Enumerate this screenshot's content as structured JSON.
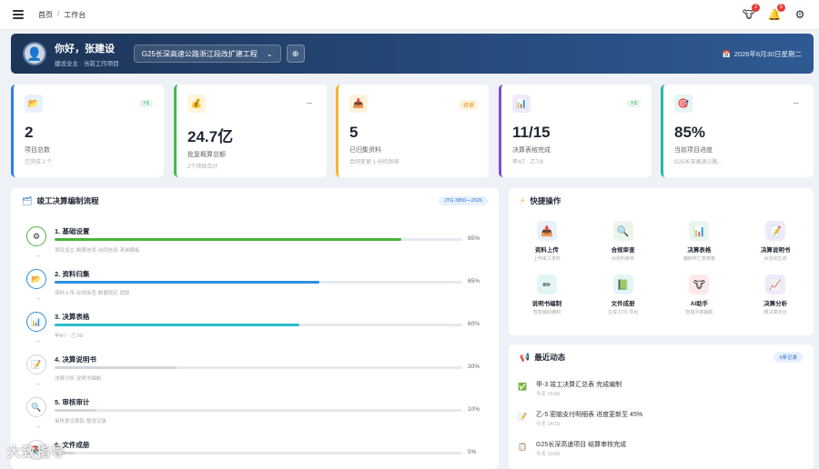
{
  "breadcrumb": {
    "home": "首页",
    "separator": "/",
    "current": "工作台"
  },
  "topbar": {
    "icons": [
      {
        "name": "mascot-icon",
        "glyph": "🐮",
        "badge": "2"
      },
      {
        "name": "bell-icon",
        "glyph": "🔔",
        "badge": "5"
      },
      {
        "name": "gear-icon",
        "glyph": "⚙",
        "badge": ""
      }
    ]
  },
  "hero": {
    "greeting": "你好，张建设",
    "subtitle": "建设业主 · 当前工作项目",
    "project": "G25长深高速公路浙江段改扩建工程",
    "date": "2026年6月30日星期二"
  },
  "stats": [
    {
      "icon": "📂",
      "tag": "+1",
      "value": "2",
      "label": "项目总数",
      "sub": "已完成 2 个",
      "accent": "#2f7fe0",
      "tagColor": "#1fa34a",
      "tagBg": "#e6f6ea",
      "iconBg": "#e8f1fd"
    },
    {
      "icon": "💰",
      "tag": "—",
      "value": "24.7亿",
      "label": "批复概算总额",
      "sub": "2个项目合计",
      "accent": "#46b84f",
      "tagColor": "#555",
      "tagBg": "transparent",
      "iconBg": "#fdf6dc"
    },
    {
      "icon": "📥",
      "tag": "待审",
      "value": "5",
      "label": "已归集资料",
      "sub": "合同变更 1 份待审核",
      "accent": "#f2b630",
      "tagColor": "#e08a00",
      "tagBg": "#fff3de",
      "iconBg": "#fdf3dd"
    },
    {
      "icon": "📊",
      "tag": "+2",
      "value": "11/15",
      "label": "决算表格完成",
      "sub": "甲4/7 · 乙7/8",
      "accent": "#7b4fd3",
      "tagColor": "#1fa34a",
      "tagBg": "#e6f6ea",
      "iconBg": "#efe9fb"
    },
    {
      "icon": "🎯",
      "tag": "—",
      "value": "85%",
      "label": "当前项目进度",
      "sub": "G25长深高速公路...",
      "accent": "#2ab6b0",
      "tagColor": "#555",
      "tagBg": "transparent",
      "iconBg": "#e3f6f5"
    }
  ],
  "flow": {
    "title": "竣工决算编制流程",
    "chip": "JTG 3850—2026",
    "steps": [
      {
        "title": "1. 基础设置",
        "pct": "85%",
        "progress": 0.85,
        "desc": "项目设立·概算信息·合同信息·清单模板",
        "icon": "⚙",
        "color": "#49b53a",
        "ring": "#49b53a"
      },
      {
        "title": "2. 资料归集",
        "pct": "65%",
        "progress": 0.65,
        "desc": "资料上传·合规审查·数据锁定·提取",
        "icon": "📂",
        "color": "#2b8ee0",
        "ring": "#2b8ee0"
      },
      {
        "title": "3. 决算表格",
        "pct": "60%",
        "progress": 0.6,
        "desc": "甲4/7 · 乙7/8",
        "icon": "📊",
        "color": "#2bbdd0",
        "ring": "#2b8ee0"
      },
      {
        "title": "4. 决算说明书",
        "pct": "30%",
        "progress": 0.3,
        "desc": "决算分析·说明书编制",
        "icon": "📝",
        "color": "#d3d6db",
        "ring": "#cfd3d9"
      },
      {
        "title": "5. 审核审计",
        "pct": "10%",
        "progress": 0.1,
        "desc": "审核意见跟踪·整改记录",
        "icon": "🔍",
        "color": "#d3d6db",
        "ring": "#cfd3d9"
      },
      {
        "title": "6. 文件成册",
        "pct": "5%",
        "progress": 0.05,
        "desc": "",
        "icon": "📚",
        "color": "#d3d6db",
        "ring": "#cfd3d9"
      }
    ]
  },
  "quick": {
    "title": "快捷操作",
    "items": [
      {
        "icon": "📥",
        "title": "资料上传",
        "sub": "上传竣工资料",
        "bg": "#e8f1fd"
      },
      {
        "icon": "🔍",
        "title": "合规审查",
        "sub": "AI资料审核",
        "bg": "#eaf6ea"
      },
      {
        "icon": "📊",
        "title": "决算表格",
        "sub": "编制甲乙类表格",
        "bg": "#eaf6ea"
      },
      {
        "icon": "📝",
        "title": "决算说明书",
        "sub": "AI自动生成",
        "bg": "#efe9fb"
      },
      {
        "icon": "✏",
        "title": "说明书编制",
        "sub": "智能辅助编制",
        "bg": "#e3f6f5"
      },
      {
        "icon": "📗",
        "title": "文件成册",
        "sub": "生成·打印·导出",
        "bg": "#e3f6f5"
      },
      {
        "icon": "🐮",
        "title": "AI助手",
        "sub": "智能问答辅助",
        "bg": "#fde9e7"
      },
      {
        "icon": "📈",
        "title": "决算分析",
        "sub": "概决算对比",
        "bg": "#efe9fb"
      }
    ]
  },
  "recent": {
    "title": "最近动态",
    "chip": "6条记录",
    "items": [
      {
        "icon": "✅",
        "text": "甲-3 竣工决算汇总表 完成编制",
        "time": "今天 16:50"
      },
      {
        "icon": "📝",
        "text": "乙-5 密脑支付明细表 进度更新至 45%",
        "time": "今天 14:15"
      },
      {
        "icon": "📋",
        "text": "G25长深高速项目 结算审核完成",
        "time": "今天 10:00"
      }
    ]
  },
  "watermark": "大致指导"
}
